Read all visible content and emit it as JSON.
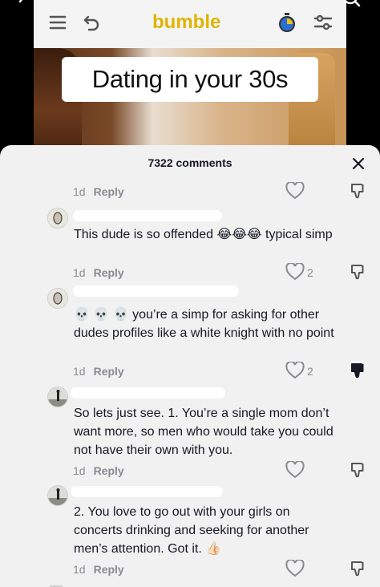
{
  "video": {
    "app_name": "bumble",
    "caption": "Dating in your 30s"
  },
  "comments_panel": {
    "count_label": "7322 comments",
    "reply_label": "Reply",
    "comments": [
      {
        "time": "1d",
        "likes": ""
      },
      {
        "text": "This dude is so offended 😂😂😂 typical simp",
        "time": "1d",
        "likes": "2"
      },
      {
        "text": "💀 💀 💀 you’re a simp for asking for other dudes profiles like a white knight with no point",
        "time": "1d",
        "likes": "2"
      },
      {
        "text": "So lets just see. 1. You’re a single mom don’t want more, so men who would take you could not have their own with you.",
        "time": "1d",
        "likes": ""
      },
      {
        "text": "2. You love to go out with your girls on concerts drinking and seeking for another men’s attention. Got it. 👍🏻",
        "time": "1d",
        "likes": ""
      }
    ]
  },
  "colors": {
    "sheet_bg": "#f1f1f2",
    "text": "#161823",
    "meta": "#8a8b91",
    "brand_yellow": "#e0b400"
  },
  "icons": [
    "menu-icon",
    "undo-icon",
    "stopwatch-icon",
    "filter-icon",
    "back-chevron-icon",
    "search-icon",
    "close-icon",
    "heart-icon",
    "dislike-icon"
  ]
}
